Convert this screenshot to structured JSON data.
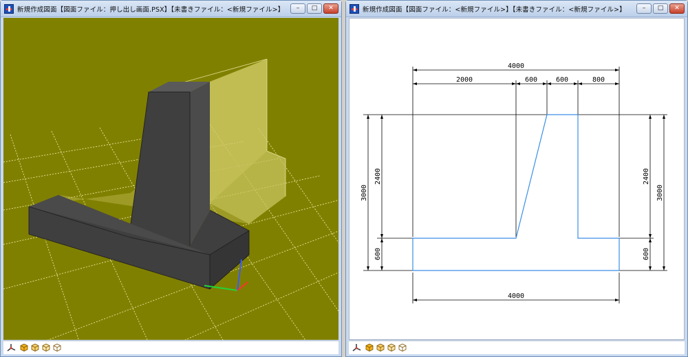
{
  "windows": {
    "left": {
      "title": "新規作成図面【図面ファイル：押し出し画面.PSX】【未書きファイル：<新規ファイル>】",
      "view_background": "#808000",
      "status_icons": [
        "axis-icon",
        "cube-icon",
        "cube-icon",
        "cube-icon",
        "cube-icon"
      ]
    },
    "right": {
      "title": "新規作成図面【図面ファイル：<新規ファイル>】【未書きファイル：<新規ファイル>】",
      "status_icons": [
        "axis-icon",
        "cube-icon",
        "cube-icon",
        "cube-icon",
        "cube-icon"
      ]
    }
  },
  "window_buttons": {
    "minimize": "–",
    "maximize": "□",
    "close": "✕"
  },
  "drawing": {
    "dims_top": {
      "overall": "4000",
      "seg1": "2000",
      "seg2": "600",
      "seg3": "600",
      "seg4": "800"
    },
    "dim_bottom": "4000",
    "dims_left": {
      "overall": "3000",
      "upper": "2400",
      "lower": "600"
    },
    "dims_right": {
      "overall": "3000",
      "upper": "2400",
      "lower": "600"
    },
    "outline_color": "#3a8ee6"
  }
}
